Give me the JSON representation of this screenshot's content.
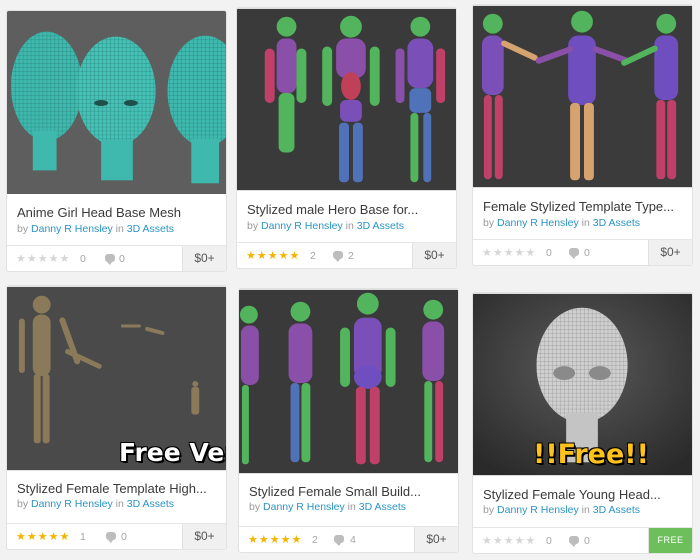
{
  "cards": [
    {
      "title": "Anime Girl Head Base Mesh",
      "by": "by",
      "author": "Danny R Hensley",
      "in": "in",
      "category": "3D Assets",
      "rating": "0",
      "comments": "0",
      "price": "$0+",
      "stars_on": 0
    },
    {
      "title": "Stylized male Hero Base for...",
      "by": "by",
      "author": "Danny R Hensley",
      "in": "in",
      "category": "3D Assets",
      "rating": "2",
      "comments": "2",
      "price": "$0+",
      "stars_on": 5
    },
    {
      "title": "Female Stylized Template Type...",
      "by": "by",
      "author": "Danny R Hensley",
      "in": "in",
      "category": "3D Assets",
      "rating": "0",
      "comments": "0",
      "price": "$0+",
      "stars_on": 0
    },
    {
      "title": "Stylized Female Template High...",
      "by": "by",
      "author": "Danny R Hensley",
      "in": "in",
      "category": "3D Assets",
      "rating": "1",
      "comments": "0",
      "price": "$0+",
      "stars_on": 5,
      "overlay": "Free Versi"
    },
    {
      "title": "Stylized Female Small Build...",
      "by": "by",
      "author": "Danny R Hensley",
      "in": "in",
      "category": "3D Assets",
      "rating": "2",
      "comments": "4",
      "price": "$0+",
      "stars_on": 5
    },
    {
      "title": "Stylized Female Young Head...",
      "by": "by",
      "author": "Danny R Hensley",
      "in": "in",
      "category": "3D Assets",
      "rating": "0",
      "comments": "0",
      "price": "FREE",
      "stars_on": 0,
      "overlay": "!!Free!!"
    }
  ],
  "colors": {
    "link": "#2a93c4",
    "star_on": "#f3b400",
    "star_off": "#d6d6d6",
    "free_badge": "#6dbf5b",
    "mesh_teal": "#3fb8ad"
  },
  "icons": {
    "rating": "star-icon",
    "comments": "comment-bubble-icon"
  }
}
